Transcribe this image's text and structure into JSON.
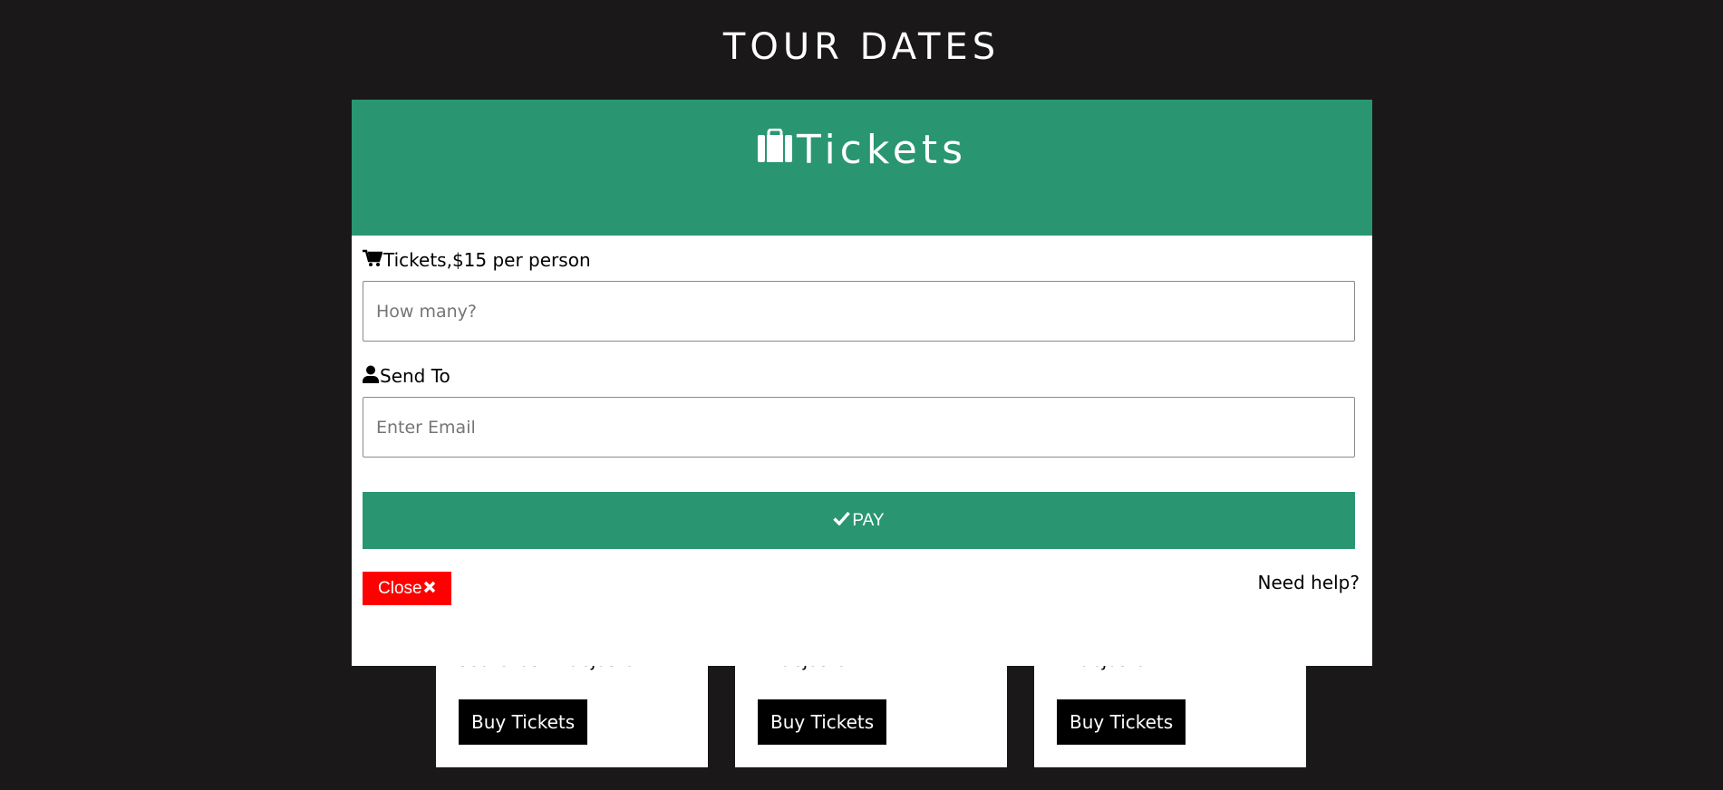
{
  "page": {
    "title": "TOUR DATES"
  },
  "cards": [
    {
      "partial_text": "sedtellus vitaejusto.",
      "button_label": "Buy Tickets"
    },
    {
      "partial_text": "vitaejusto.",
      "button_label": "Buy Tickets"
    },
    {
      "partial_text": "vitaejusto.",
      "button_label": "Buy Tickets"
    }
  ],
  "modal": {
    "title": "Tickets",
    "title_icon": "suitcase-icon",
    "tickets_label": "Tickets,$15 per person",
    "tickets_icon": "shopping-cart-icon",
    "tickets_placeholder": "How many?",
    "send_label": "Send To",
    "send_icon": "user-icon",
    "email_placeholder": "Enter Email",
    "pay_label": "PAY",
    "pay_icon": "check-icon",
    "close_label": "Close",
    "close_icon": "x-icon",
    "help_text": "Need help?"
  },
  "colors": {
    "page_bg": "#1a1818",
    "accent_green": "#299671",
    "close_red": "#ff0000",
    "card_button_bg": "#000000"
  }
}
